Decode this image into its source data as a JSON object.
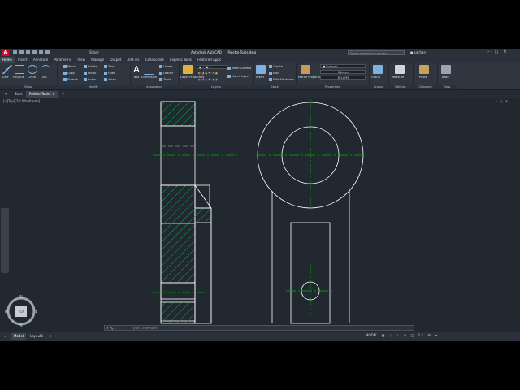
{
  "app": {
    "title": "Autodesk AutoCAD",
    "file": "Palette Tools.dwg",
    "logo": "A",
    "share": "Share",
    "search_placeholder": "Type a keyword or phrase",
    "user": "sachan"
  },
  "menu_tabs": [
    "Home",
    "Insert",
    "Annotate",
    "Parametric",
    "View",
    "Manage",
    "Output",
    "Add-ins",
    "Collaborate",
    "Express Tools",
    "Featured Apps"
  ],
  "ribbon": {
    "draw": {
      "title": "Draw",
      "tools": [
        "Line",
        "Polyline",
        "Circle",
        "Arc"
      ]
    },
    "modify": {
      "title": "Modify",
      "tools": [
        "Move",
        "Rotate",
        "Trim",
        "Copy",
        "Mirror",
        "Fillet",
        "Stretch",
        "Scale",
        "Array"
      ]
    },
    "annotation": {
      "title": "Annotation",
      "tools": [
        "Text",
        "Dimension",
        "Linear",
        "Leader",
        "Table"
      ]
    },
    "layers": {
      "title": "Layers",
      "tools": [
        "Layer Properties",
        "Make Current",
        "Match Layer"
      ]
    },
    "block": {
      "title": "Block",
      "tools": [
        "Insert",
        "Create",
        "Edit",
        "Edit Attributes"
      ]
    },
    "properties": {
      "title": "Properties",
      "tools": [
        "Match Properties",
        "ByLayer",
        "ByLayer",
        "BYLAYER"
      ]
    },
    "groups": {
      "title": "Groups",
      "tools": [
        "Group"
      ]
    },
    "utilities": {
      "title": "Utilities",
      "tools": [
        "Measure"
      ]
    },
    "clipboard": {
      "title": "Clipboard",
      "tools": [
        "Paste"
      ]
    },
    "view": {
      "title": "View",
      "tools": [
        "Base"
      ]
    }
  },
  "doc_tabs": [
    "Start",
    "Palette Tools*"
  ],
  "viewport_label": "[-][Top][2D Wireframe]",
  "command_placeholder": "Type a command",
  "layout_tabs": [
    "Model",
    "Layout1"
  ],
  "status": {
    "model": "MODEL",
    "scale": "1:1"
  },
  "navcube": {
    "top": "TOP",
    "north": "N",
    "south": "S",
    "east": "E",
    "west": "W"
  },
  "colors": {
    "accent": "#c8102e",
    "centerline": "#00b400",
    "geometry": "#ffffff",
    "hatch": "#0fa84a",
    "background": "#212830"
  }
}
